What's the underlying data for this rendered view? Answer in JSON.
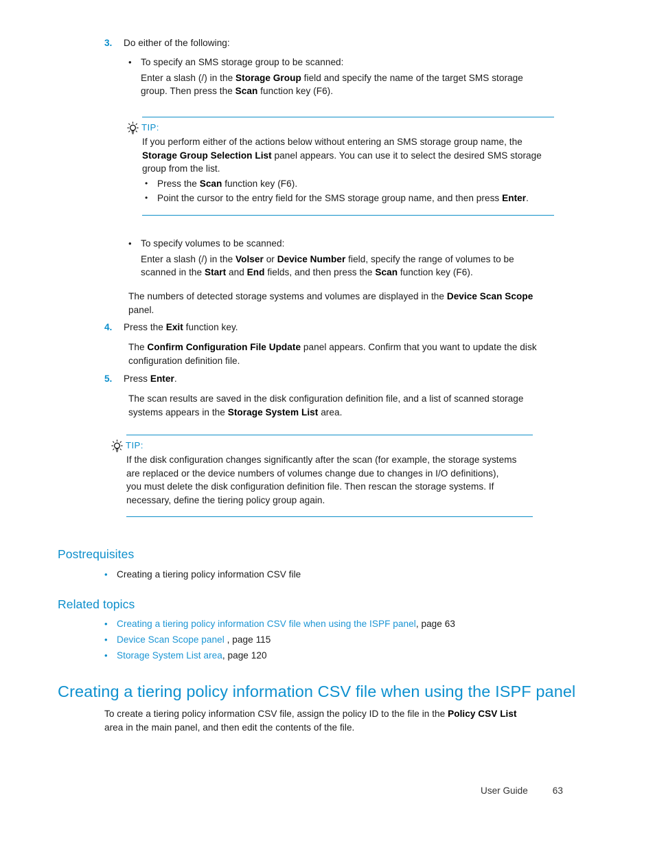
{
  "page": {
    "number": "63",
    "footer_label": "User Guide"
  },
  "colors": {
    "accent_blue": "#0b8ecb",
    "heading_blue": "#0d90cf",
    "link_blue": "#1b95d4",
    "rule_blue": "#0e8ec9",
    "body_text": "#1a1a1a"
  },
  "steps": {
    "step3": {
      "number": "3.",
      "text": "Do either of the following:",
      "bullet1": {
        "lead": "To specify an SMS storage group to be scanned:",
        "body_1": "Enter a slash (/) in the ",
        "body_b1": "Storage Group",
        "body_2": " field and specify the name of the target SMS storage",
        "body_3": "group. Then press the ",
        "body_b2": "Scan",
        "body_4": " function key (F6)."
      },
      "bullet2": {
        "lead": "To specify volumes to be scanned:",
        "body_1": "Enter a slash (/) in the ",
        "body_b1": "Volser",
        "body_2": " or ",
        "body_b2": "Device Number",
        "body_3": " field, specify the range of volumes to be",
        "body_4": "scanned in the ",
        "body_b3": "Start",
        "body_5": " and ",
        "body_b4": "End",
        "body_6": " fields, and then press the ",
        "body_b5": "Scan",
        "body_7": " function key (F6)."
      },
      "closing": {
        "line1_a": "The numbers of detected storage systems and volumes are displayed in the ",
        "line1_b": "Device Scan Scope",
        "line2": "panel."
      }
    },
    "step4": {
      "number": "4.",
      "text_a": "Press the ",
      "text_b": "Exit",
      "text_c": " function key.",
      "para_a": "The ",
      "para_b": "Confirm Configuration File Update",
      "para_c": " panel appears. Confirm that you want to update the disk",
      "para_d": "configuration definition file."
    },
    "step5": {
      "number": "5.",
      "text_a": "Press ",
      "text_b": "Enter",
      "text_c": ".",
      "para_a": "The scan results are saved in the disk configuration definition file, and a list of scanned storage",
      "para_b": "systems appears in the ",
      "para_c": "Storage System List",
      "para_d": " area."
    }
  },
  "tip1": {
    "icon": "lightbulb-icon",
    "label": "TIP:",
    "line1": "If you perform either of the actions below without entering an SMS storage group name, the",
    "line2_b": "Storage Group Selection List",
    "line2_rest": " panel appears. You can use it to select the desired SMS storage",
    "line3": "group from the list.",
    "bullets": [
      {
        "marker": "•",
        "a": "Press the ",
        "b": "Scan",
        "c": " function key (F6)."
      },
      {
        "marker": "•",
        "a": "Point the cursor to the entry field for the SMS storage group name, and then press ",
        "b": "Enter",
        "c": "."
      }
    ]
  },
  "tip2": {
    "icon": "lightbulb-icon",
    "label": "TIP:",
    "line1": "If the disk configuration changes significantly after the scan (for example, the storage systems",
    "line2": "are replaced or the device numbers of volumes change due to changes in I/O definitions),",
    "line3": "you must delete the disk configuration definition file. Then rescan the storage systems. If",
    "line4": "necessary, define the tiering policy group again."
  },
  "postrequisites": {
    "heading": "Postrequisites",
    "items": [
      {
        "marker": "•",
        "text": "Creating a tiering policy information CSV file"
      }
    ]
  },
  "related_topics": {
    "heading": "Related topics",
    "items": [
      {
        "marker": "•",
        "link": "Creating a tiering policy information CSV file when using the ISPF panel",
        "suffix": ", page 63"
      },
      {
        "marker": "•",
        "link": "Device Scan Scope panel ",
        "suffix": ", page 115"
      },
      {
        "marker": "•",
        "link": "Storage System List area",
        "suffix": ", page 120"
      }
    ]
  },
  "chapter": {
    "heading": "Creating a tiering policy information CSV file when using the ISPF panel",
    "para_a": "To create a tiering policy information CSV file, assign the policy ID to the file in the ",
    "para_b": "Policy CSV List",
    "para_c": "area in the main panel, and then edit the contents of the file."
  }
}
